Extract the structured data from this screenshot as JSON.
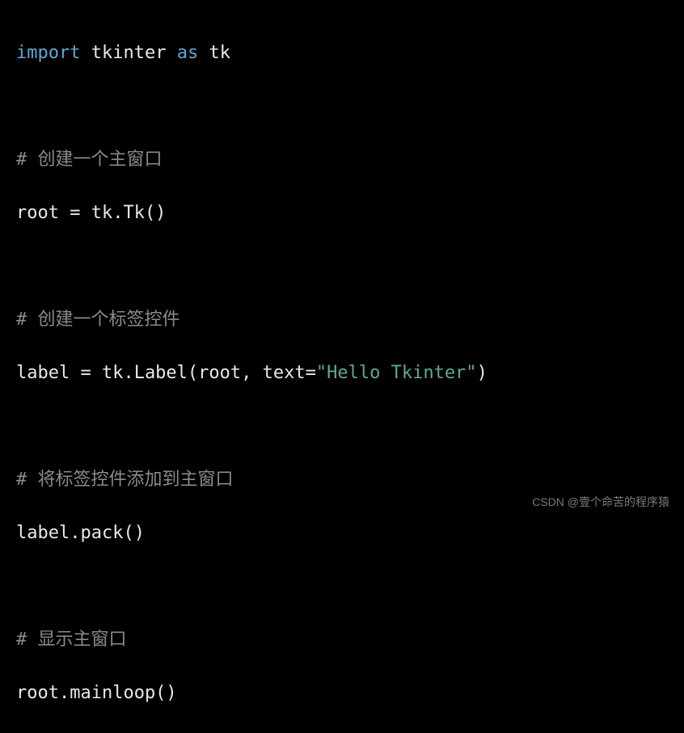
{
  "code": {
    "line1_import": "import",
    "line1_module": " tkinter ",
    "line1_as": "as",
    "line1_alias": " tk",
    "blank": "",
    "line3_comment": "# 创建一个主窗口",
    "line4": "root = tk.Tk()",
    "line6_comment": "# 创建一个标签控件",
    "line7_a": "label = tk.Label(root, text=",
    "line7_str": "\"Hello Tkinter\"",
    "line7_b": ")",
    "line9_comment": "# 将标签控件添加到主窗口",
    "line10": "label.pack()",
    "line12_comment": "# 显示主窗口",
    "line13": "root.mainloop()"
  },
  "watermark": "CSDN @壹个命苦的程序猿"
}
